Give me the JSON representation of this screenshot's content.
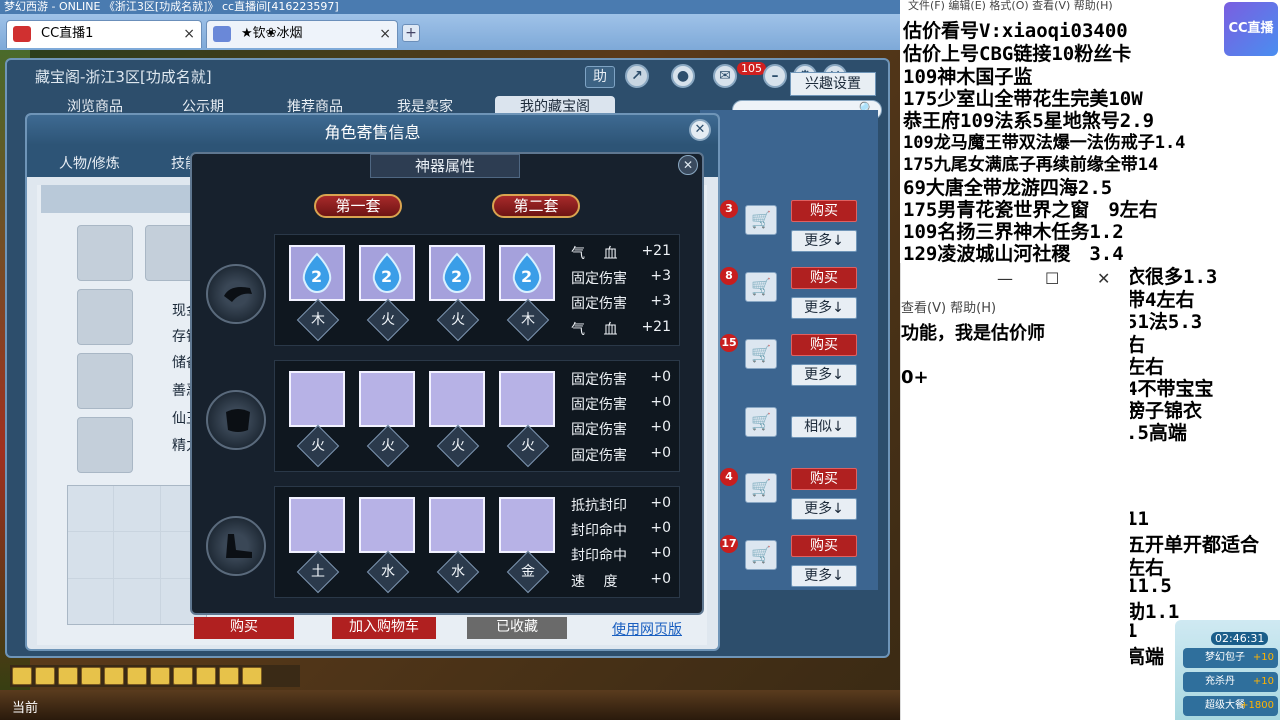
{
  "browser": {
    "title": "梦幻西游 - ONLINE   《浙江3区[功成名就]》 cc直播间[416223597]",
    "tabs": [
      {
        "label": "CC直播1"
      },
      {
        "label": "★钦❀冰烟"
      }
    ],
    "new_tab": "+",
    "close_glyph": "×"
  },
  "cbg": {
    "title": "藏宝阁-浙江3区[功成名就]",
    "tabs": [
      "浏览商品",
      "公示期",
      "推荐商品",
      "我是卖家",
      "我的藏宝阁"
    ],
    "help": "助",
    "msg_count": "105",
    "interest_settings": "兴趣设置",
    "rows": [
      {
        "badge": "3",
        "buy": "购买",
        "more": "更多↓"
      },
      {
        "badge": "8",
        "buy": "购买",
        "more": "更多↓"
      },
      {
        "badge": "15",
        "buy": "购买",
        "more": "更多↓"
      },
      {
        "badge": "",
        "buy": "",
        "more": "相似↓"
      },
      {
        "badge": "4",
        "buy": "购买",
        "more": "更多↓"
      },
      {
        "badge": "17",
        "buy": "购买",
        "more": "更多↓"
      }
    ]
  },
  "role": {
    "title": "角色寄售信息",
    "tabs": [
      "人物/修炼",
      "技能"
    ],
    "stats": [
      "现金",
      "存银",
      "储备",
      "善恶",
      "仙玉",
      "精力"
    ],
    "footer": {
      "buy": "购买",
      "add_cart": "加入购物车",
      "favorited": "已收藏",
      "web_link": "使用网页版"
    }
  },
  "artifact": {
    "title": "神器属性",
    "set1": "第一套",
    "set2": "第二套",
    "groups": [
      {
        "elements": [
          "木",
          "火",
          "火",
          "木"
        ],
        "filled": true,
        "attrs": [
          {
            "label": "气　 血",
            "value": "+21"
          },
          {
            "label": "固定伤害",
            "value": "+3"
          },
          {
            "label": "固定伤害",
            "value": "+3"
          },
          {
            "label": "气　 血",
            "value": "+21"
          }
        ]
      },
      {
        "elements": [
          "火",
          "火",
          "火",
          "火"
        ],
        "filled": false,
        "attrs": [
          {
            "label": "固定伤害",
            "value": "+0"
          },
          {
            "label": "固定伤害",
            "value": "+0"
          },
          {
            "label": "固定伤害",
            "value": "+0"
          },
          {
            "label": "固定伤害",
            "value": "+0"
          }
        ]
      },
      {
        "elements": [
          "土",
          "水",
          "水",
          "金"
        ],
        "filled": false,
        "attrs": [
          {
            "label": "抵抗封印",
            "value": "+0"
          },
          {
            "label": "封印命中",
            "value": "+0"
          },
          {
            "label": "封印命中",
            "value": "+0"
          },
          {
            "label": "速　 度",
            "value": "+0"
          }
        ]
      }
    ]
  },
  "game": {
    "bottom_label": "当前"
  },
  "overlay": {
    "menu": "文件(F)   编辑(E)   格式(O)   查看(V)   帮助(H)",
    "logo": "CC直播",
    "lines": [
      "估价看号V:xiaoqi03400",
      "估价上号CBG链接10粉丝卡",
      "109神木国子监",
      "175少室山全带花生完美10W",
      "恭王府109法系5星地煞号2.9",
      "109龙马魔王带双法爆一法伤戒子1.4",
      "175九尾女满底子再续前缘全带14",
      "69大唐全带龙游四海2.5",
      "175男青花瓷世界之窗　9左右",
      "109名扬三界神木任务1.2",
      "129凌波城山河社稷　3.4"
    ],
    "right_fragments": [
      "衣很多1.3",
      "带4左右",
      "51法5.3",
      "右",
      "左右",
      "4不带宝宝",
      "膀子锦衣",
      ".5高端",
      "11",
      "五开单开都适合",
      "左右",
      "11.5",
      "助1.1",
      "1",
      "高端"
    ],
    "notepad": {
      "menu": "查看(V)   帮助(H)",
      "text1": "功能，我是估价师",
      "text2": "0+",
      "min": "—",
      "max": "☐",
      "close": "✕"
    },
    "gift": {
      "time": "02:46:31",
      "rows": [
        {
          "name": "梦幻包子",
          "amount": "+10"
        },
        {
          "name": "充杀丹",
          "amount": "+10"
        },
        {
          "name": "超级大餐",
          "amount": "+1800"
        }
      ]
    }
  }
}
